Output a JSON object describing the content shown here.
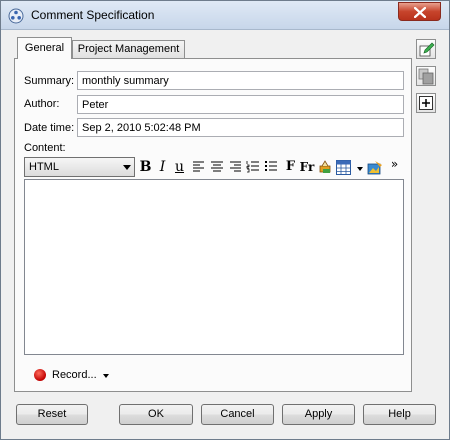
{
  "window": {
    "title": "Comment Specification"
  },
  "tabs": [
    {
      "label": "General"
    },
    {
      "label": "Project Management"
    }
  ],
  "form": {
    "summary_label": "Summary:",
    "summary_value": "monthly summary",
    "author_label": "Author:",
    "author_value": "Peter",
    "datetime_label": "Date time:",
    "datetime_value": "Sep 2, 2010 5:02:48 PM",
    "content_label": "Content:"
  },
  "toolbar": {
    "format_selected": "HTML",
    "bold": "B",
    "italic": "I",
    "underline": "u",
    "font": "F",
    "font_size": "Fr",
    "more": "»"
  },
  "record": {
    "label": "Record..."
  },
  "buttons": {
    "reset": "Reset",
    "ok": "OK",
    "cancel": "Cancel",
    "apply": "Apply",
    "help": "Help"
  },
  "icons": {
    "window_icon": "gear-cluster-icon",
    "close": "close-icon",
    "align_left": "align-left-icon",
    "align_center": "align-center-icon",
    "align_right": "align-right-icon",
    "ordered_list": "ordered-list-icon",
    "unordered_list": "unordered-list-icon",
    "highlight": "highlight-icon",
    "insert_table": "insert-table-icon",
    "insert_image": "insert-image-icon",
    "side_edit": "edit-icon",
    "side_copy": "copy-icon",
    "side_add": "add-icon"
  },
  "colors": {
    "record": "#cc0000",
    "title_bar": "#dfe9f5",
    "close_button": "#c7442c"
  }
}
